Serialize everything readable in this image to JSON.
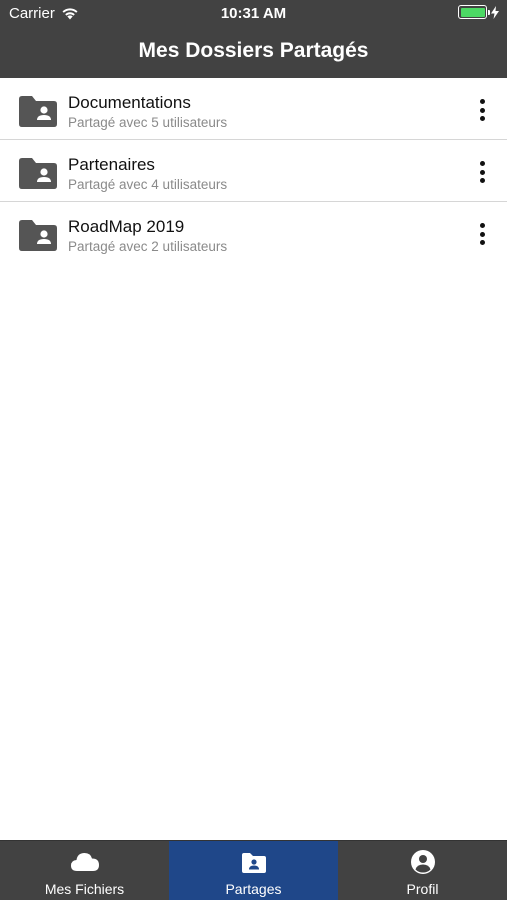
{
  "status_bar": {
    "carrier": "Carrier",
    "time": "10:31 AM",
    "battery_color": "#4cd964"
  },
  "header": {
    "title": "Mes Dossiers Partagés",
    "background": "#424242"
  },
  "folders": [
    {
      "name": "Documentations",
      "subtitle": "Partagé avec 5 utilisateurs",
      "icon": "shared-folder-icon"
    },
    {
      "name": "Partenaires",
      "subtitle": "Partagé avec 4 utilisateurs",
      "icon": "shared-folder-icon"
    },
    {
      "name": "RoadMap 2019",
      "subtitle": "Partagé avec 2 utilisateurs",
      "icon": "shared-folder-icon"
    }
  ],
  "tabbar": {
    "active_color": "#1f4789",
    "tabs": [
      {
        "label": "Mes Fichiers",
        "icon": "cloud-icon",
        "active": false
      },
      {
        "label": "Partages",
        "icon": "shared-folder-icon",
        "active": true
      },
      {
        "label": "Profil",
        "icon": "user-circle-icon",
        "active": false
      }
    ]
  }
}
